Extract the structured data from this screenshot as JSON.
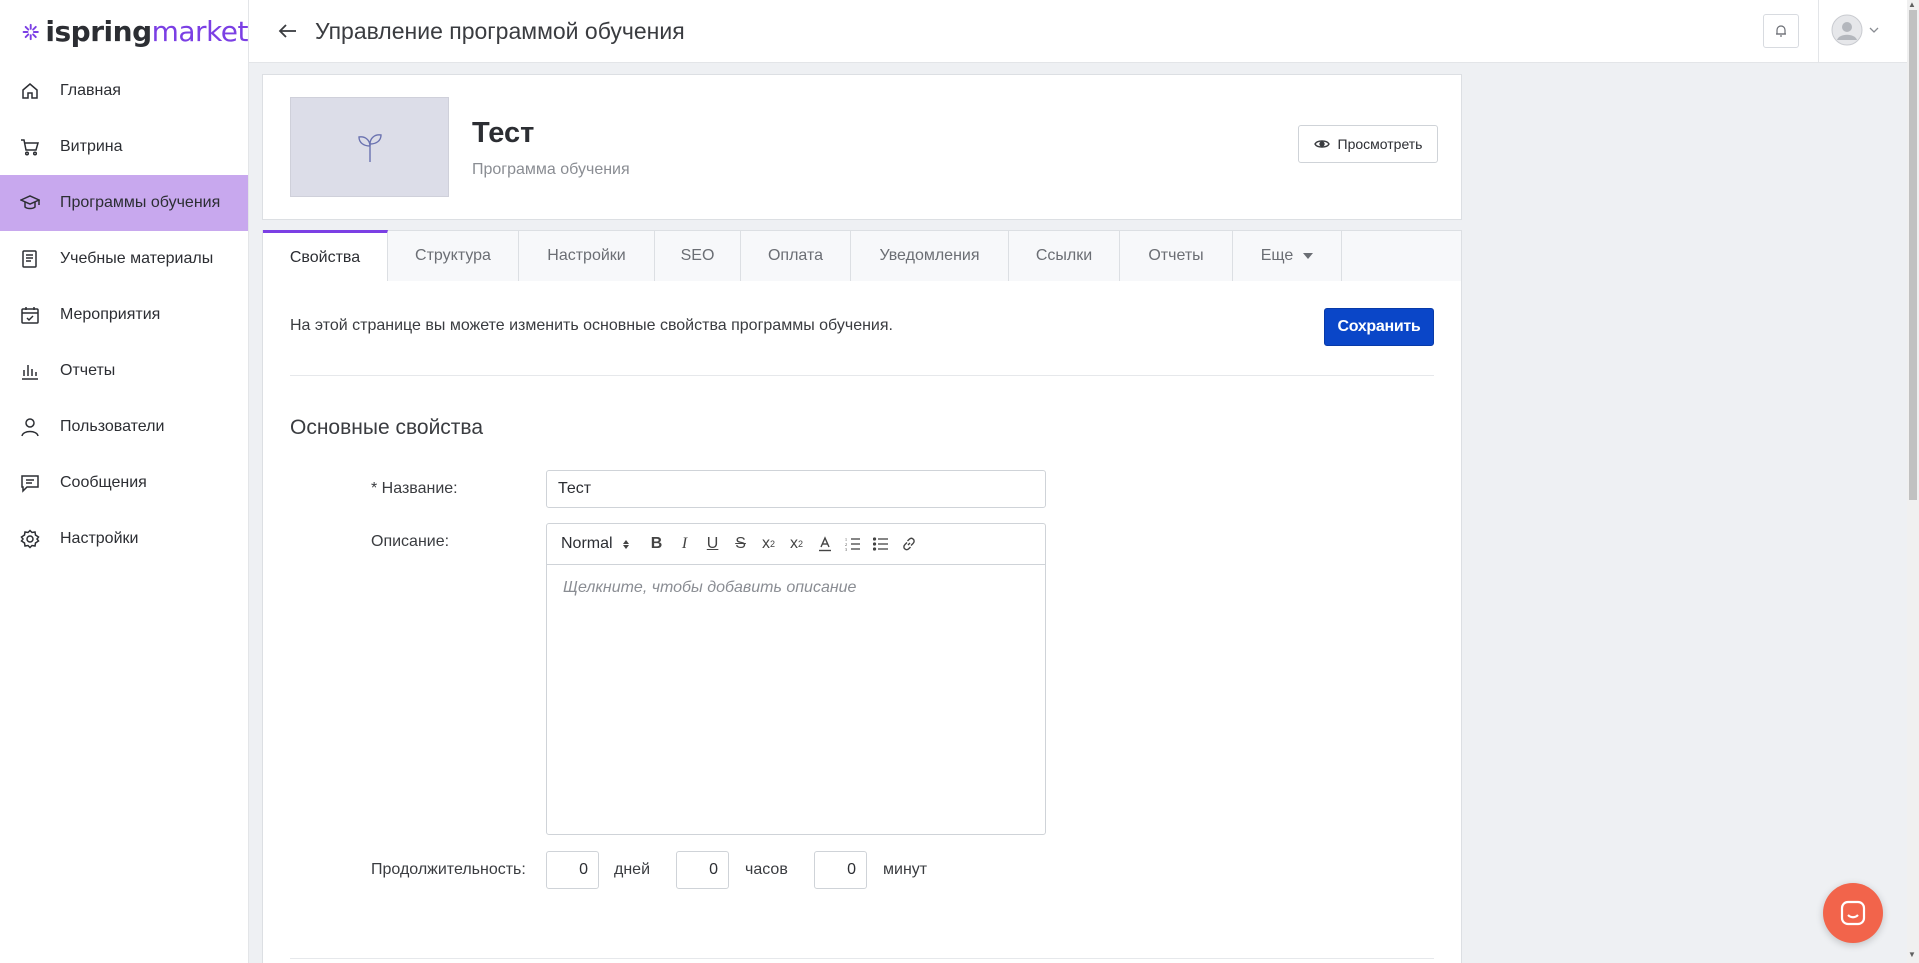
{
  "brand": {
    "part1": "ispring",
    "part2": "market",
    "accent": "#7b3fe4"
  },
  "sidebar": {
    "items": [
      {
        "label": "Главная",
        "icon": "home-icon"
      },
      {
        "label": "Витрина",
        "icon": "cart-icon"
      },
      {
        "label": "Программы обучения",
        "icon": "graduation-cap-icon",
        "active": true
      },
      {
        "label": "Учебные материалы",
        "icon": "book-icon"
      },
      {
        "label": "Мероприятия",
        "icon": "calendar-check-icon"
      },
      {
        "label": "Отчеты",
        "icon": "bar-chart-icon"
      },
      {
        "label": "Пользователи",
        "icon": "user-icon"
      },
      {
        "label": "Сообщения",
        "icon": "message-icon"
      },
      {
        "label": "Настройки",
        "icon": "gear-icon"
      }
    ]
  },
  "header": {
    "title": "Управление программой обучения"
  },
  "program": {
    "title": "Тест",
    "subtitle": "Программа обучения",
    "view_label": "Просмотреть"
  },
  "tabs": [
    {
      "label": "Свойства",
      "active": true
    },
    {
      "label": "Структура"
    },
    {
      "label": "Настройки"
    },
    {
      "label": "SEO"
    },
    {
      "label": "Оплата"
    },
    {
      "label": "Уведомления"
    },
    {
      "label": "Ссылки"
    },
    {
      "label": "Отчеты"
    },
    {
      "label": "Еще"
    }
  ],
  "main": {
    "info_text": "На этой странице вы можете изменить основные свойства программы обучения.",
    "save_label": "Сохранить",
    "section_title": "Основные свойства",
    "name_label": "* Название:",
    "name_value": "Тест",
    "description_label": "Описание:",
    "editor": {
      "format": "Normal",
      "placeholder": "Щелкните, чтобы добавить описание"
    },
    "duration_label": "Продолжительность:",
    "duration": {
      "days": "0",
      "days_unit": "дней",
      "hours": "0",
      "hours_unit": "часов",
      "minutes": "0",
      "minutes_unit": "минут"
    }
  }
}
